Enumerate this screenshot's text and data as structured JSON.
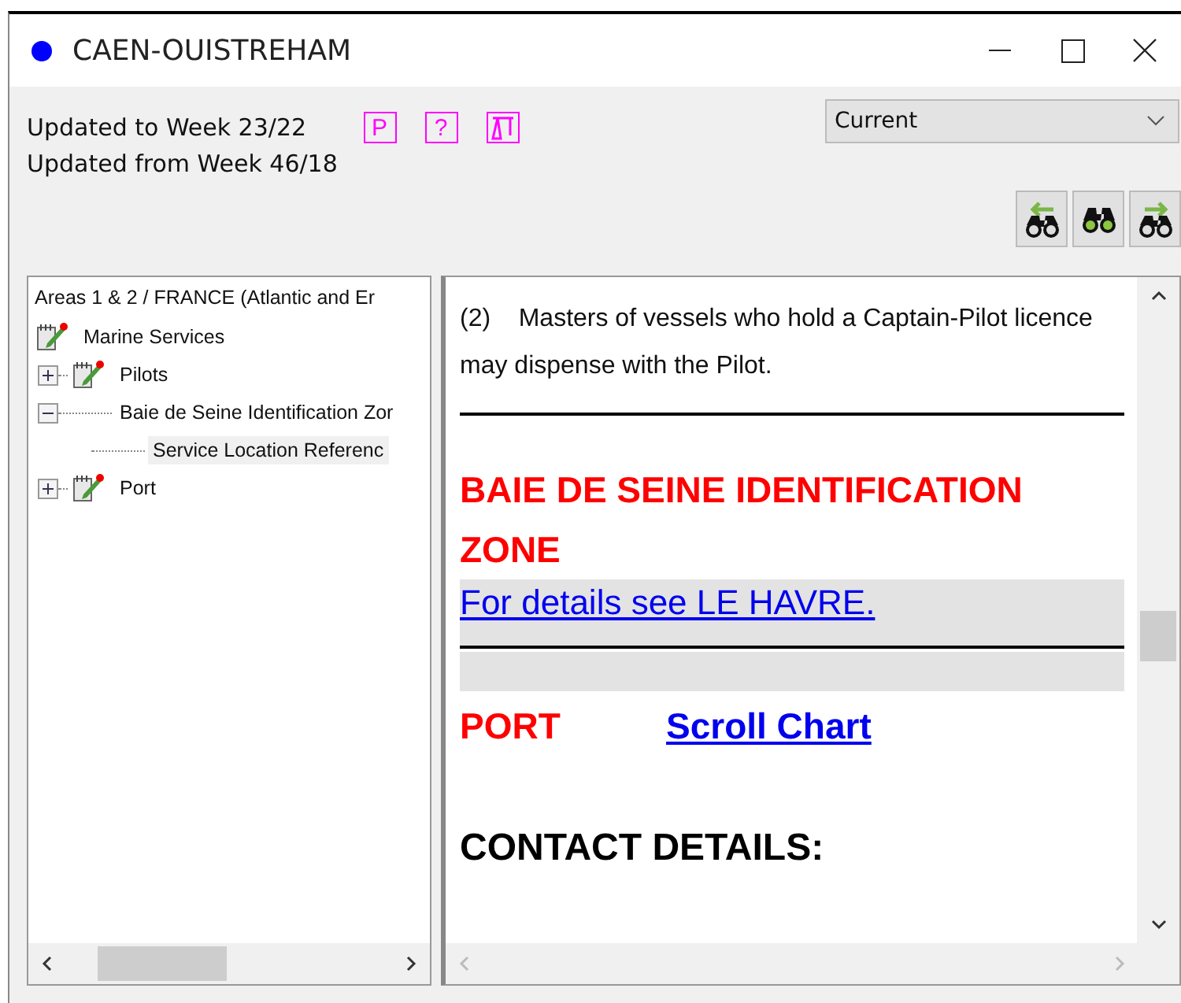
{
  "window": {
    "title": "CAEN-OUISTREHAM"
  },
  "updates": [
    "Updated to Week 23/22",
    "Updated from Week 46/18"
  ],
  "badges": [
    {
      "kind": "text",
      "label": "P"
    },
    {
      "kind": "text",
      "label": "?"
    },
    {
      "kind": "crane"
    }
  ],
  "edition_select": {
    "value": "Current"
  },
  "search_buttons": [
    {
      "kind": "previous"
    },
    {
      "kind": "find"
    },
    {
      "kind": "next"
    }
  ],
  "tree": {
    "header": "Areas 1 & 2 / FRANCE (Atlantic and Er",
    "items": [
      {
        "label": "Marine Services",
        "icon": true,
        "selected": false,
        "children": [
          {
            "label": "Pilots",
            "icon": true,
            "expanded": false,
            "selected": false
          },
          {
            "label": "Baie de Seine Identification Zor",
            "icon": false,
            "expanded": true,
            "selected": false,
            "children": [
              {
                "label": "Service Location Referenc",
                "icon": false,
                "selected": true
              }
            ]
          },
          {
            "label": "Port",
            "icon": true,
            "expanded": false,
            "selected": false
          }
        ]
      }
    ]
  },
  "content": [
    {
      "kind": "paragraph",
      "text": "(2)    Masters of vessels who hold a Captain-Pilot licence may dispense with the Pilot."
    },
    {
      "kind": "rule"
    },
    {
      "kind": "heading",
      "text": "BAIE DE SEINE IDENTIFICATION ZONE"
    },
    {
      "kind": "link",
      "text": "For details see LE HAVRE."
    },
    {
      "kind": "rule"
    },
    {
      "kind": "band"
    },
    {
      "kind": "section",
      "text": "PORT",
      "link": "Scroll Chart"
    },
    {
      "kind": "subheading",
      "text": "CONTACT DETAILS:"
    }
  ]
}
